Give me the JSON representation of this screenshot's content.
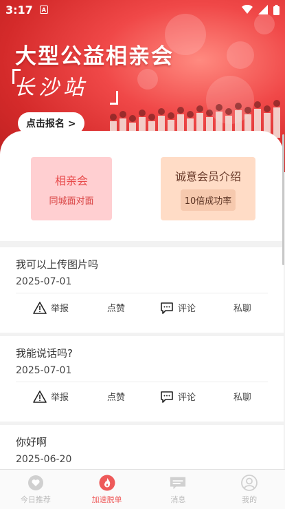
{
  "status": {
    "time": "3:17",
    "notif_letter": "A"
  },
  "banner": {
    "title": "大型公益相亲会",
    "script_text": "长沙站",
    "signup_label": "点击报名 >"
  },
  "features": [
    {
      "title": "相亲会",
      "subtitle": "同城面对面"
    },
    {
      "title": "诚意会员介绍",
      "subtitle": "10倍成功率"
    }
  ],
  "actions": {
    "report": "举报",
    "like": "点赞",
    "comment": "评论",
    "chat": "私聊"
  },
  "posts": [
    {
      "text": "我可以上传图片吗",
      "date": "2025-07-01"
    },
    {
      "text": "我能说话吗?",
      "date": "2025-07-01"
    },
    {
      "text": "你好啊",
      "date": "2025-06-20"
    }
  ],
  "nav": [
    {
      "label": "今日推荐",
      "icon": "heart-icon"
    },
    {
      "label": "加速脱单",
      "icon": "flame-icon"
    },
    {
      "label": "消息",
      "icon": "message-icon"
    },
    {
      "label": "我的",
      "icon": "person-icon"
    }
  ],
  "colors": {
    "accent": "#ee5a5a",
    "banner": "#e23b3b",
    "pink_card": "#ffcfd1",
    "peach_card": "#ffdcc6"
  }
}
